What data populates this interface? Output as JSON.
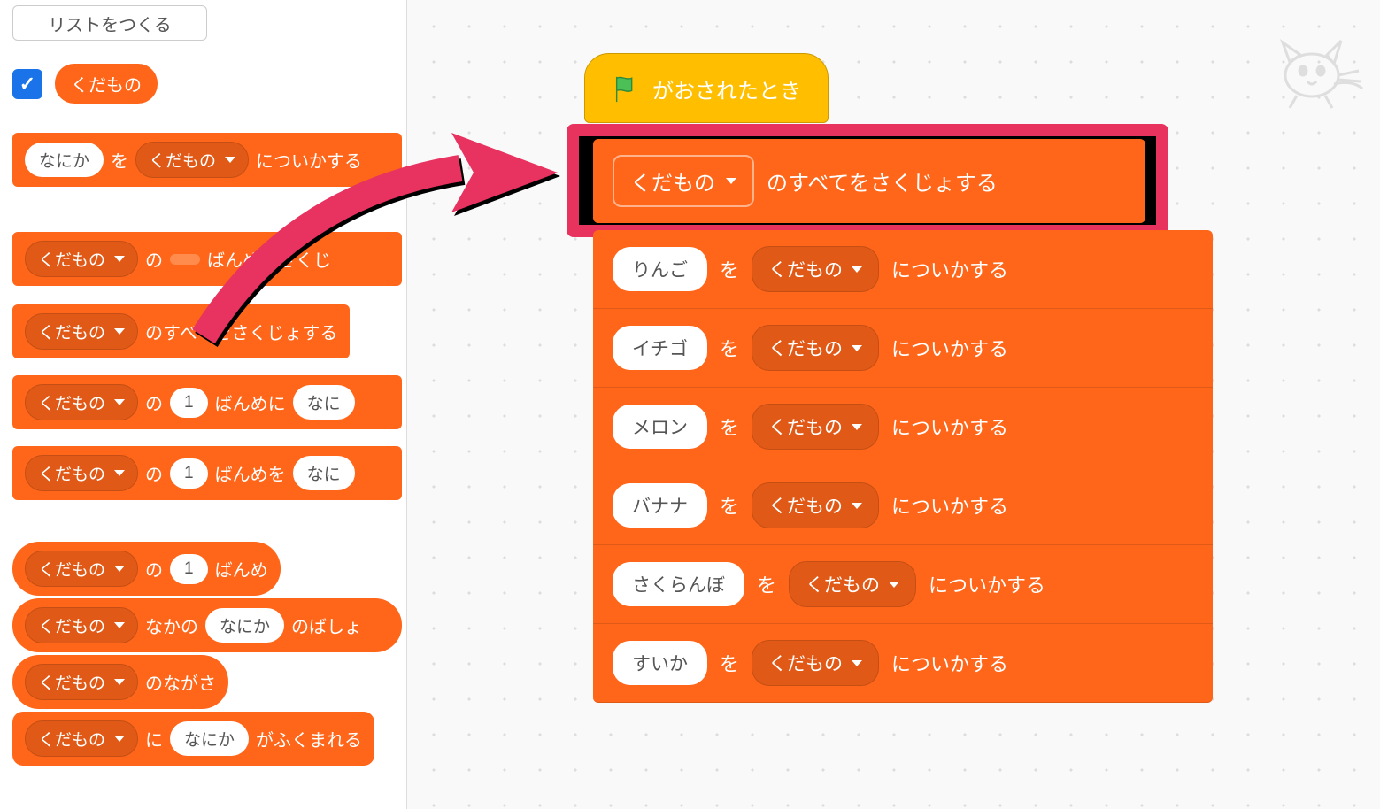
{
  "palette": {
    "make_list_label": "リストをつくる",
    "checkbox_checked": true,
    "list_name": "くだもの",
    "blocks": {
      "add": {
        "input": "なにか",
        "txt1": "を",
        "dd": "くだもの",
        "txt2": "についかする"
      },
      "delete_nth": {
        "dd": "くだもの",
        "txt1": "の",
        "txt2": "ばんめをさくじ"
      },
      "delete_all": {
        "dd": "くだもの",
        "txt": "のすべてをさくじょする"
      },
      "insert": {
        "dd": "くだもの",
        "txt1": "の",
        "num": "1",
        "txt2": "ばんめに",
        "input": "なに"
      },
      "replace": {
        "dd": "くだもの",
        "txt1": "の",
        "num": "1",
        "txt2": "ばんめを",
        "input": "なに"
      },
      "item": {
        "dd": "くだもの",
        "txt1": "の",
        "num": "1",
        "txt2": "ばんめ"
      },
      "index_of": {
        "dd": "くだもの",
        "txt1": "なかの",
        "input": "なにか",
        "txt2": "のばしょ"
      },
      "length": {
        "dd": "くだもの",
        "txt": "のながさ"
      },
      "contains": {
        "dd": "くだもの",
        "txt1": "に",
        "input": "なにか",
        "txt2": "がふくまれる"
      }
    }
  },
  "workspace": {
    "hat_label": "がおされたとき",
    "highlighted": {
      "dd": "くだもの",
      "txt": "のすべてをさくじょする"
    },
    "txt_wo": "を",
    "txt_append": "についかする",
    "dd_list": "くだもの",
    "stack": [
      {
        "val": "りんご"
      },
      {
        "val": "イチゴ"
      },
      {
        "val": "メロン"
      },
      {
        "val": "バナナ"
      },
      {
        "val": "さくらんぼ"
      },
      {
        "val": "すいか"
      }
    ]
  }
}
